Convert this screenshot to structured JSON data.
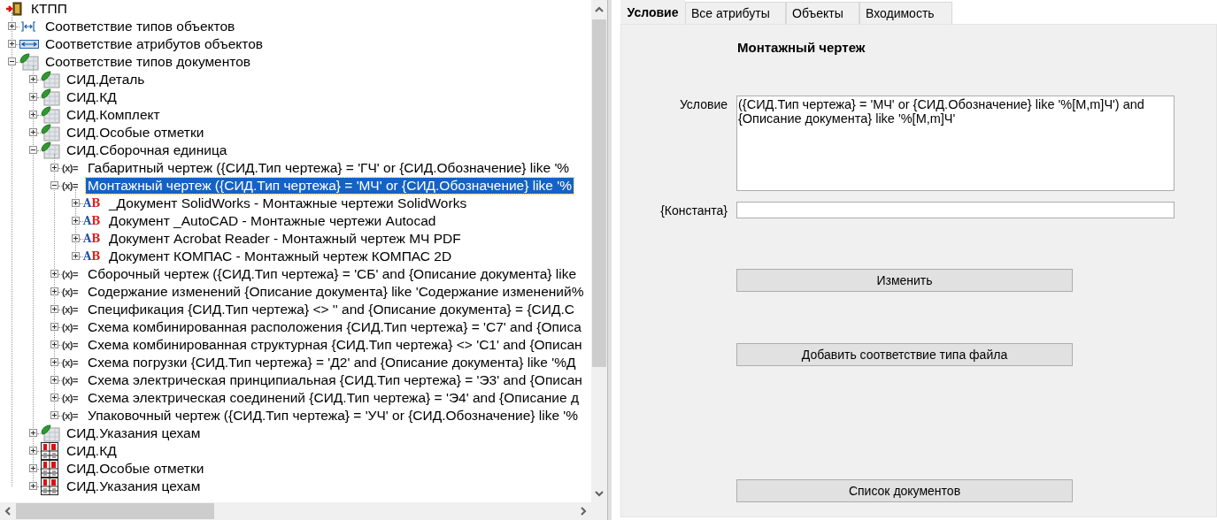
{
  "tree": {
    "root": {
      "label": "КТПП",
      "kind": "root",
      "selected": false,
      "children": [
        {
          "label": "Соответствие типов объектов",
          "kind": "mapping",
          "expanded": false,
          "selected": false
        },
        {
          "label": "Соответствие атрибутов объектов",
          "kind": "attribute",
          "expanded": false,
          "selected": false
        },
        {
          "label": "Соответствие типов документов",
          "kind": "doctype",
          "expanded": true,
          "selected": false,
          "children": [
            {
              "label": "СИД.Деталь",
              "kind": "doctype",
              "expanded": false,
              "selected": false
            },
            {
              "label": "СИД.КД",
              "kind": "doctype",
              "expanded": false,
              "selected": false
            },
            {
              "label": "СИД.Комплект",
              "kind": "doctype",
              "expanded": false,
              "selected": false
            },
            {
              "label": "СИД.Особые отметки",
              "kind": "doctype",
              "expanded": false,
              "selected": false
            },
            {
              "label": "СИД.Сборочная единица",
              "kind": "doctype",
              "expanded": true,
              "selected": false,
              "children": [
                {
                  "label": "Габаритный чертеж ({СИД.Тип чертежа} = 'ГЧ' or {СИД.Обозначение} like '%",
                  "kind": "condition",
                  "glyph": "(x)=",
                  "expanded": false,
                  "selected": false
                },
                {
                  "label": "Монтажный чертеж ({СИД.Тип чертежа} = 'МЧ' or {СИД.Обозначение} like '%",
                  "kind": "condition",
                  "glyph": "(x)=",
                  "expanded": true,
                  "selected": true,
                  "children": [
                    {
                      "label": "_Документ SolidWorks - Монтажные чертежи SolidWorks",
                      "kind": "file",
                      "glyph": "AB",
                      "expanded": false,
                      "selected": false
                    },
                    {
                      "label": "Документ _AutoCAD - Монтажные чертежи Autocad",
                      "kind": "file",
                      "glyph": "AB",
                      "expanded": false,
                      "selected": false
                    },
                    {
                      "label": "Документ Acrobat Reader - Монтажный чертеж МЧ PDF",
                      "kind": "file",
                      "glyph": "AB",
                      "expanded": false,
                      "selected": false
                    },
                    {
                      "label": "Документ КОМПАС - Монтажный чертеж КОМПАС 2D",
                      "kind": "file",
                      "glyph": "AB",
                      "expanded": false,
                      "selected": false
                    }
                  ]
                },
                {
                  "label": "Сборочный чертеж ({СИД.Тип чертежа} = 'СБ' and {Описание документа} like",
                  "kind": "condition",
                  "glyph": "(x)=",
                  "expanded": false,
                  "selected": false
                },
                {
                  "label": "Содержание изменений {Описание документа} like 'Содержание изменений%",
                  "kind": "condition",
                  "glyph": "(x)=",
                  "expanded": false,
                  "selected": false
                },
                {
                  "label": "Спецификация {СИД.Тип чертежа} <> '' and {Описание документа} = {СИД.С",
                  "kind": "condition",
                  "glyph": "(x)=",
                  "expanded": false,
                  "selected": false
                },
                {
                  "label": "Схема комбинированная расположения {СИД.Тип чертежа} = 'С7' and {Описа",
                  "kind": "condition",
                  "glyph": "(x)=",
                  "expanded": false,
                  "selected": false
                },
                {
                  "label": "Схема комбинированная структурная {СИД.Тип чертежа} <> 'С1' and {Описан",
                  "kind": "condition",
                  "glyph": "(x)=",
                  "expanded": false,
                  "selected": false
                },
                {
                  "label": "Схема погрузки {СИД.Тип чертежа} = 'Д2' and {Описание документа} like '%Д",
                  "kind": "condition",
                  "glyph": "(x)=",
                  "expanded": false,
                  "selected": false
                },
                {
                  "label": "Схема электрическая принципиальная {СИД.Тип чертежа} = 'Э3' and {Описан",
                  "kind": "condition",
                  "glyph": "(x)=",
                  "expanded": false,
                  "selected": false
                },
                {
                  "label": "Схема электрическая соединений {СИД.Тип чертежа} = 'Э4' and {Описание д",
                  "kind": "condition",
                  "glyph": "(x)=",
                  "expanded": false,
                  "selected": false
                },
                {
                  "label": "Упаковочный чертеж ({СИД.Тип чертежа} = 'УЧ' or {СИД.Обозначение} like '%",
                  "kind": "condition",
                  "glyph": "(x)=",
                  "expanded": false,
                  "selected": false
                }
              ]
            },
            {
              "label": "СИД.Указания цехам",
              "kind": "doctype",
              "expanded": false,
              "selected": false
            },
            {
              "label": "СИД.КД",
              "kind": "numbered",
              "expanded": false,
              "selected": false
            },
            {
              "label": "СИД.Особые отметки",
              "kind": "numbered",
              "expanded": false,
              "selected": false
            },
            {
              "label": "СИД.Указания цехам",
              "kind": "numbered",
              "expanded": false,
              "selected": false
            }
          ]
        }
      ]
    }
  },
  "tabs": [
    {
      "label": "Условие",
      "selected": true
    },
    {
      "label": "Все атрибуты",
      "selected": false
    },
    {
      "label": "Объекты",
      "selected": false
    },
    {
      "label": "Входимость",
      "selected": false
    }
  ],
  "panel": {
    "title": "Монтажный чертеж",
    "fields": [
      {
        "label": "Условие",
        "kind": "textarea",
        "value": "({СИД.Тип чертежа} = 'МЧ' or {СИД.Обозначение} like '%[M,m]Ч') and {Описание документа} like '%[M,m]Ч'"
      },
      {
        "label": "{Константа}",
        "kind": "input"
      }
    ],
    "buttons": [
      "Изменить",
      "Добавить соответствие типа файла",
      "Список документов"
    ]
  }
}
